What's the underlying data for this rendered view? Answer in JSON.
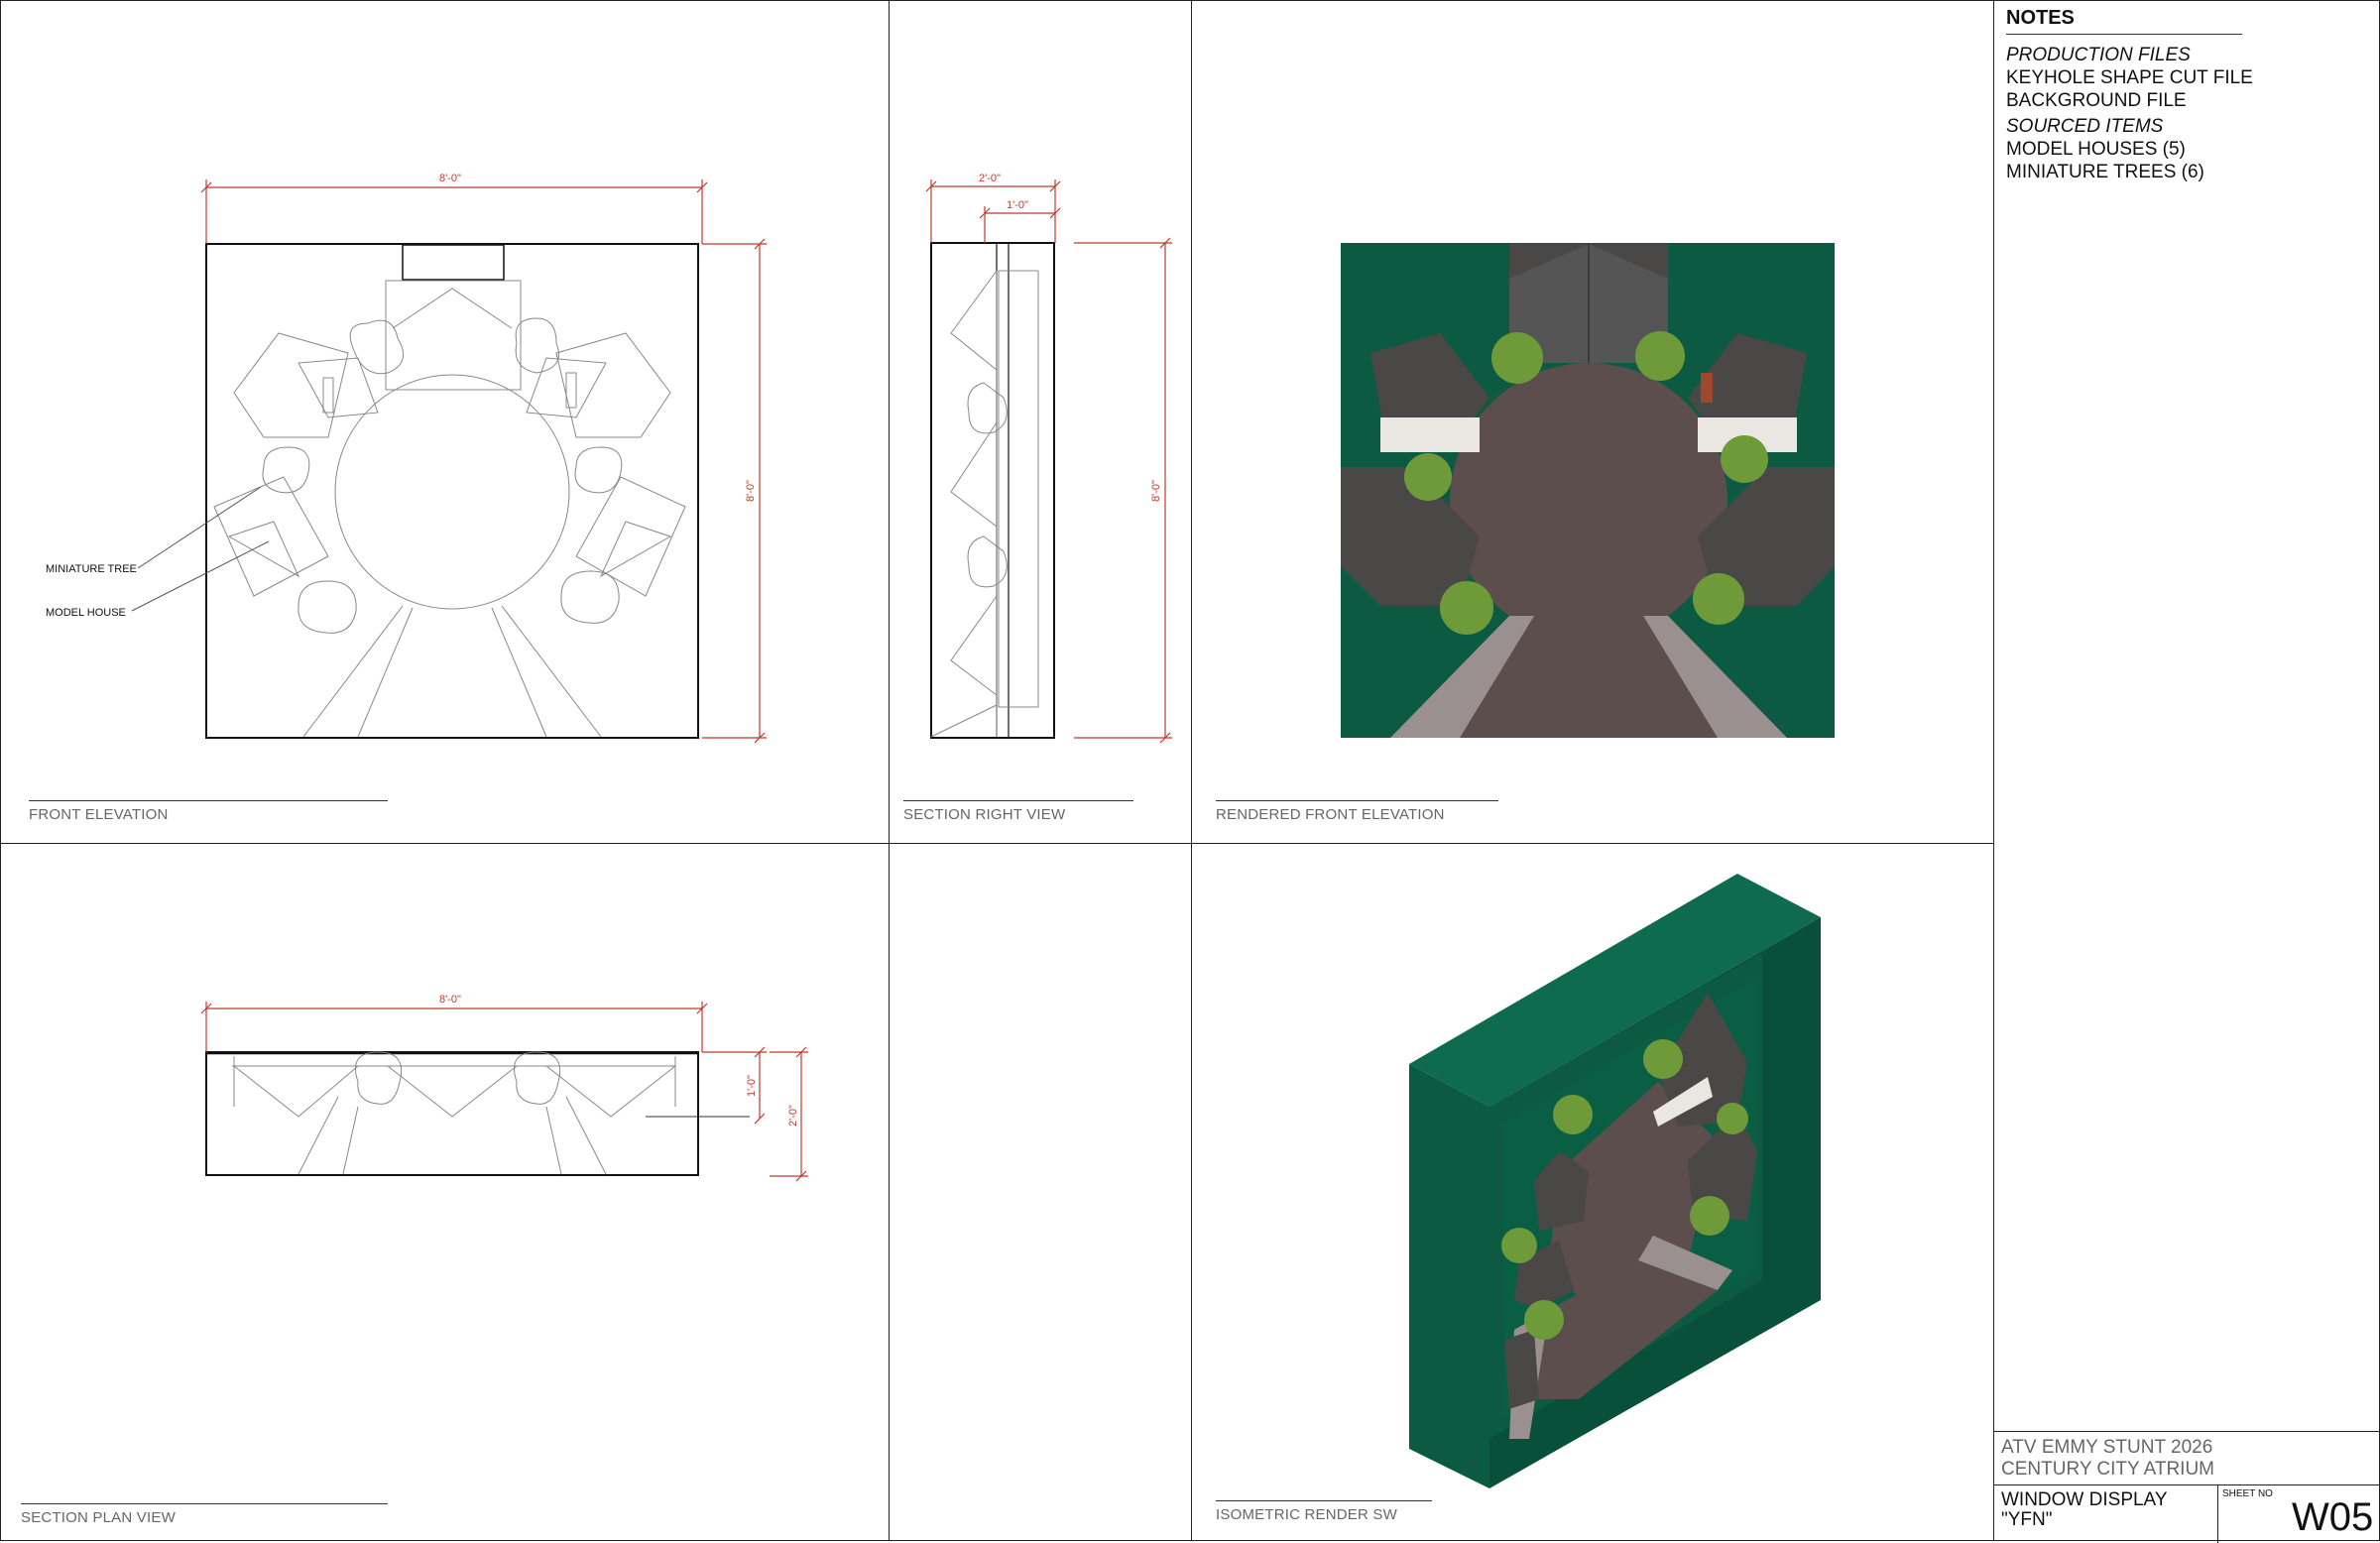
{
  "notes": {
    "title": "NOTES",
    "sections": [
      {
        "heading": "PRODUCTION FILES",
        "items": [
          "KEYHOLE SHAPE CUT FILE",
          "BACKGROUND FILE"
        ]
      },
      {
        "heading": "SOURCED ITEMS",
        "items": [
          "MODEL HOUSES (5)",
          "MINIATURE TREES (6)"
        ]
      }
    ]
  },
  "title_block": {
    "project_line1": "ATV EMMY STUNT 2026",
    "project_line2": "CENTURY CITY ATRIUM",
    "drawing_line1": "WINDOW DISPLAY",
    "drawing_line2": "\"YFN\"",
    "sheet_no_label": "SHEET NO",
    "sheet_no": "W05"
  },
  "views": {
    "front_elevation": {
      "caption": "FRONT ELEVATION",
      "dim_width": "8'-0\"",
      "dim_height": "8'-0\"",
      "callout_tree": "MINIATURE TREE",
      "callout_house": "MODEL HOUSE"
    },
    "section_right": {
      "caption": "SECTION RIGHT VIEW",
      "dim_depth": "2'-0\"",
      "dim_inner": "1'-0\"",
      "dim_height": "8'-0\""
    },
    "rendered_front": {
      "caption": "RENDERED FRONT ELEVATION"
    },
    "section_plan": {
      "caption": "SECTION PLAN VIEW",
      "dim_width": "8'-0\"",
      "dim_inner": "1'-0\"",
      "dim_depth": "2'-0\""
    },
    "isometric": {
      "caption": "ISOMETRIC RENDER SW"
    }
  },
  "colors": {
    "dimension": "#c0392b",
    "backdrop_green": "#0b5a41",
    "roof": "#4a4747",
    "ground": "#5b4e4d",
    "path": "#9a908f",
    "tree": "#6f9a3a"
  }
}
